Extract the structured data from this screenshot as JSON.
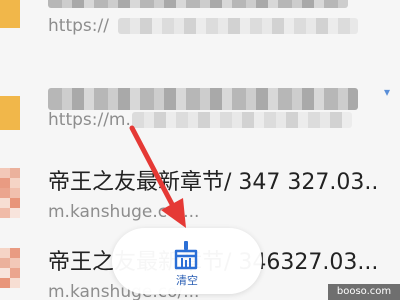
{
  "history": {
    "rows": [
      {
        "title": "",
        "url": "https://",
        "obscured": true
      },
      {
        "title": "",
        "url": "https://m.",
        "obscured": true
      },
      {
        "title": "帝王之友最新章节/ 347 327.03...",
        "url": "m.kanshuge.co/..."
      },
      {
        "title": "帝王之友最新章节/ 346327.03...",
        "url": "m.kanshuge.co/..."
      }
    ]
  },
  "toolbar": {
    "clear_label": "清空",
    "clear_icon": "broom-icon"
  },
  "annotation": {
    "arrow_color": "#e53935"
  },
  "watermark": {
    "text": "booso.com"
  },
  "colors": {
    "accent": "#2b5fb4",
    "folder": "#f1b74a"
  }
}
